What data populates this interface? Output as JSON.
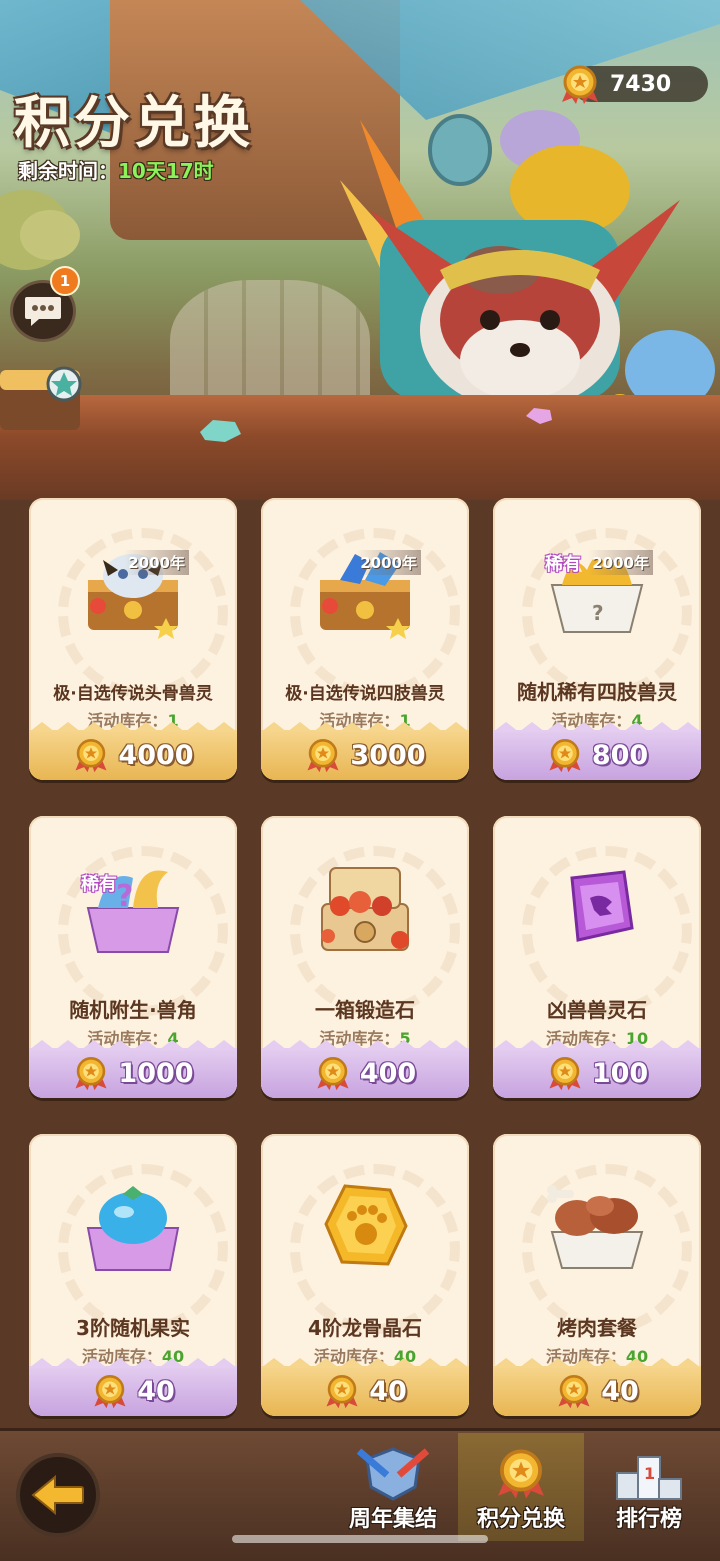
{
  "header": {
    "title": "积分兑换",
    "timer_label": "剩余时间：",
    "timer_value": "10天17时",
    "points": "7430",
    "chat_badge": "1"
  },
  "items": [
    {
      "name": "极·自选传说头骨兽灵",
      "stock_label": "活动库存：",
      "stock": "1",
      "price": "4000",
      "year_tag": "2000年",
      "rare_tag": "",
      "price_style": "gold",
      "icon": "legendary-skull-chest-icon"
    },
    {
      "name": "极·自选传说四肢兽灵",
      "stock_label": "活动库存：",
      "stock": "1",
      "price": "3000",
      "year_tag": "2000年",
      "rare_tag": "",
      "price_style": "gold",
      "icon": "legendary-limb-chest-icon"
    },
    {
      "name": "随机稀有四肢兽灵",
      "stock_label": "活动库存：",
      "stock": "4",
      "price": "800",
      "year_tag": "2000年",
      "rare_tag": "稀有",
      "price_style": "purple",
      "icon": "random-claw-box-icon"
    },
    {
      "name": "随机附生·兽角",
      "stock_label": "活动库存：",
      "stock": "4",
      "price": "1000",
      "year_tag": "",
      "rare_tag": "稀有",
      "price_style": "purple",
      "icon": "random-horn-box-icon"
    },
    {
      "name": "一箱锻造石",
      "stock_label": "活动库存：",
      "stock": "5",
      "price": "400",
      "year_tag": "",
      "rare_tag": "",
      "price_style": "purple",
      "icon": "forge-stone-chest-icon"
    },
    {
      "name": "凶兽兽灵石",
      "stock_label": "活动库存：",
      "stock": "10",
      "price": "100",
      "year_tag": "",
      "rare_tag": "",
      "price_style": "purple",
      "icon": "purple-beast-stone-icon"
    },
    {
      "name": "3阶随机果实",
      "stock_label": "活动库存：",
      "stock": "40",
      "price": "40",
      "year_tag": "",
      "rare_tag": "",
      "price_style": "purple",
      "icon": "blue-fruit-box-icon"
    },
    {
      "name": "4阶龙骨晶石",
      "stock_label": "活动库存：",
      "stock": "40",
      "price": "40",
      "year_tag": "",
      "rare_tag": "",
      "price_style": "gold",
      "icon": "gold-paw-crystal-icon"
    },
    {
      "name": "烤肉套餐",
      "stock_label": "活动库存：",
      "stock": "40",
      "price": "40",
      "year_tag": "",
      "rare_tag": "",
      "price_style": "purple",
      "icon": "roast-meat-box-icon"
    }
  ],
  "nav": {
    "back_icon": "back-arrow-icon",
    "tabs": [
      {
        "label": "周年集结",
        "icon": "anniversary-shield-icon",
        "active": false
      },
      {
        "label": "积分兑换",
        "icon": "points-medal-icon",
        "active": true
      },
      {
        "label": "排行榜",
        "icon": "podium-icon",
        "active": false
      }
    ]
  },
  "colors": {
    "gold_bar": "#e8b653",
    "purple_bar": "#c7a3df",
    "stock_number": "#49a52f",
    "timer_value": "#8cf25a",
    "card_bg": "#fdf1df"
  }
}
